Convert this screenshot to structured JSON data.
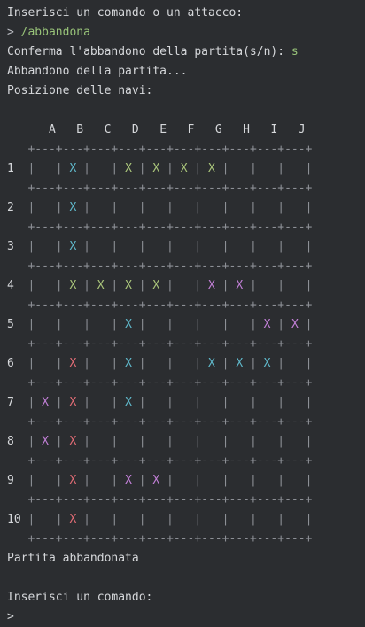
{
  "console": {
    "prompt_command": "Inserisci un comando o un attacco:",
    "entered_prefix": "> ",
    "entered_command": "/abbandona",
    "confirm_prompt": "Conferma l'abbandono della partita(s/n): ",
    "confirm_answer": "s",
    "abandoning": "Abbandono della partita...",
    "ships_position": "Posizione delle navi:",
    "abandoned": "Partita abbandonata",
    "prompt_command2": "Inserisci un comando:",
    "cursor_prompt": ">"
  },
  "board": {
    "columns": [
      "A",
      "B",
      "C",
      "D",
      "E",
      "F",
      "G",
      "H",
      "I",
      "J"
    ],
    "rows": [
      {
        "label": "1",
        "cells": [
          "",
          "green-cyan",
          "",
          "green",
          "green",
          "green",
          "green",
          "",
          "",
          ""
        ]
      },
      {
        "label": "2",
        "cells": [
          "",
          "cyan",
          "",
          "",
          "",
          "",
          "",
          "",
          "",
          ""
        ]
      },
      {
        "label": "3",
        "cells": [
          "",
          "cyan",
          "",
          "",
          "",
          "",
          "",
          "",
          "",
          ""
        ]
      },
      {
        "label": "4",
        "cells": [
          "",
          "green",
          "green",
          "green",
          "green",
          "",
          "purple",
          "purple",
          "",
          ""
        ]
      },
      {
        "label": "5",
        "cells": [
          "",
          "",
          "",
          "cyan",
          "",
          "",
          "",
          "",
          "purple",
          "purple"
        ]
      },
      {
        "label": "6",
        "cells": [
          "",
          "red",
          "",
          "cyan",
          "",
          "",
          "cyan",
          "cyan",
          "cyan",
          ""
        ]
      },
      {
        "label": "7",
        "cells": [
          "purple",
          "red",
          "",
          "cyan",
          "",
          "",
          "",
          "",
          "",
          ""
        ]
      },
      {
        "label": "8",
        "cells": [
          "purple",
          "red",
          "",
          "",
          "",
          "",
          "",
          "",
          "",
          ""
        ]
      },
      {
        "label": "9",
        "cells": [
          "",
          "red",
          "",
          "purple",
          "purple",
          "",
          "",
          "",
          "",
          ""
        ]
      },
      {
        "label": "10",
        "cells": [
          "",
          "red",
          "",
          "",
          "",
          "",
          "",
          "",
          "",
          ""
        ]
      }
    ],
    "mark": "X",
    "separator": "+---+---+---+---+---+---+---+---+---+---+"
  },
  "colors": {
    "background": "#2b2d30",
    "text": "#d6d8db",
    "command": "#98c379",
    "ship_green": "#a9c47a",
    "ship_cyan": "#5fb7c9",
    "ship_purple": "#c17fd6",
    "ship_red": "#e06c75"
  }
}
